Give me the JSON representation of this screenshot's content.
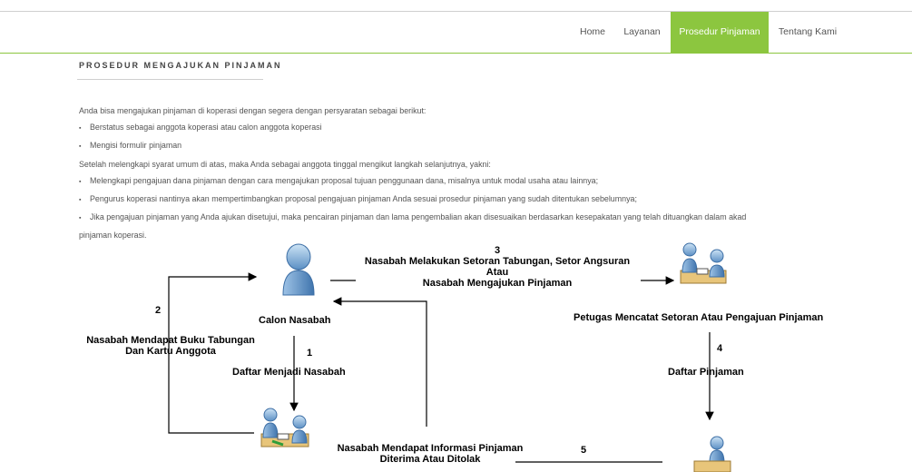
{
  "nav": {
    "items": [
      {
        "label": "Home"
      },
      {
        "label": "Layanan"
      },
      {
        "label": "Prosedur Pinjaman"
      },
      {
        "label": "Tentang Kami"
      }
    ],
    "active_index": 2,
    "accent_color": "#8cc63f"
  },
  "section": {
    "title": "PROSEDUR MENGAJUKAN PINJAMAN"
  },
  "content": {
    "intro": "Anda bisa mengajukan pinjaman di koperasi dengan segera dengan persyaratan sebagai berikut:",
    "requirements": [
      "Berstatus sebagai anggota koperasi atau calon anggota koperasi",
      "Mengisi formulir pinjaman"
    ],
    "steps_intro": "Setelah melengkapi syarat umum di atas, maka Anda sebagai anggota tinggal mengikut langkah selanjutnya, yakni:",
    "steps": [
      "Melengkapi pengajuan dana pinjaman dengan cara mengajukan proposal tujuan penggunaan dana, misalnya untuk modal usaha atau lainnya;",
      "Pengurus koperasi nantinya akan mempertimbangkan proposal pengajuan pinjaman Anda sesuai prosedur pinjaman yang sudah ditentukan sebelumnya;",
      "Jika pengajuan pinjaman yang Anda ajukan disetujui, maka pencairan pinjaman dan lama pengembalian akan disesuaikan berdasarkan kesepakatan yang telah dituangkan dalam akad"
    ],
    "steps_continuation": "pinjaman koperasi."
  },
  "diagram": {
    "calon_nasabah": "Calon Nasabah",
    "step1_number": "1",
    "step1_label": "Daftar Menjadi Nasabah",
    "step2_number": "2",
    "step2_label_line1": "Nasabah Mendapat Buku Tabungan",
    "step2_label_line2": "Dan Kartu Anggota",
    "step3_number": "3",
    "step3_line1": "Nasabah Melakukan Setoran Tabungan, Setor Angsuran",
    "step3_line2": "Atau",
    "step3_line3": "Nasabah Mengajukan Pinjaman",
    "petugas_label": "Petugas Mencatat Setoran Atau Pengajuan Pinjaman",
    "step4_number": "4",
    "step4_label": "Daftar Pinjaman",
    "step5_number": "5",
    "step5_line1": "Nasabah Mendapat Informasi Pinjaman",
    "step5_line2": "Diterima Atau Ditolak"
  }
}
